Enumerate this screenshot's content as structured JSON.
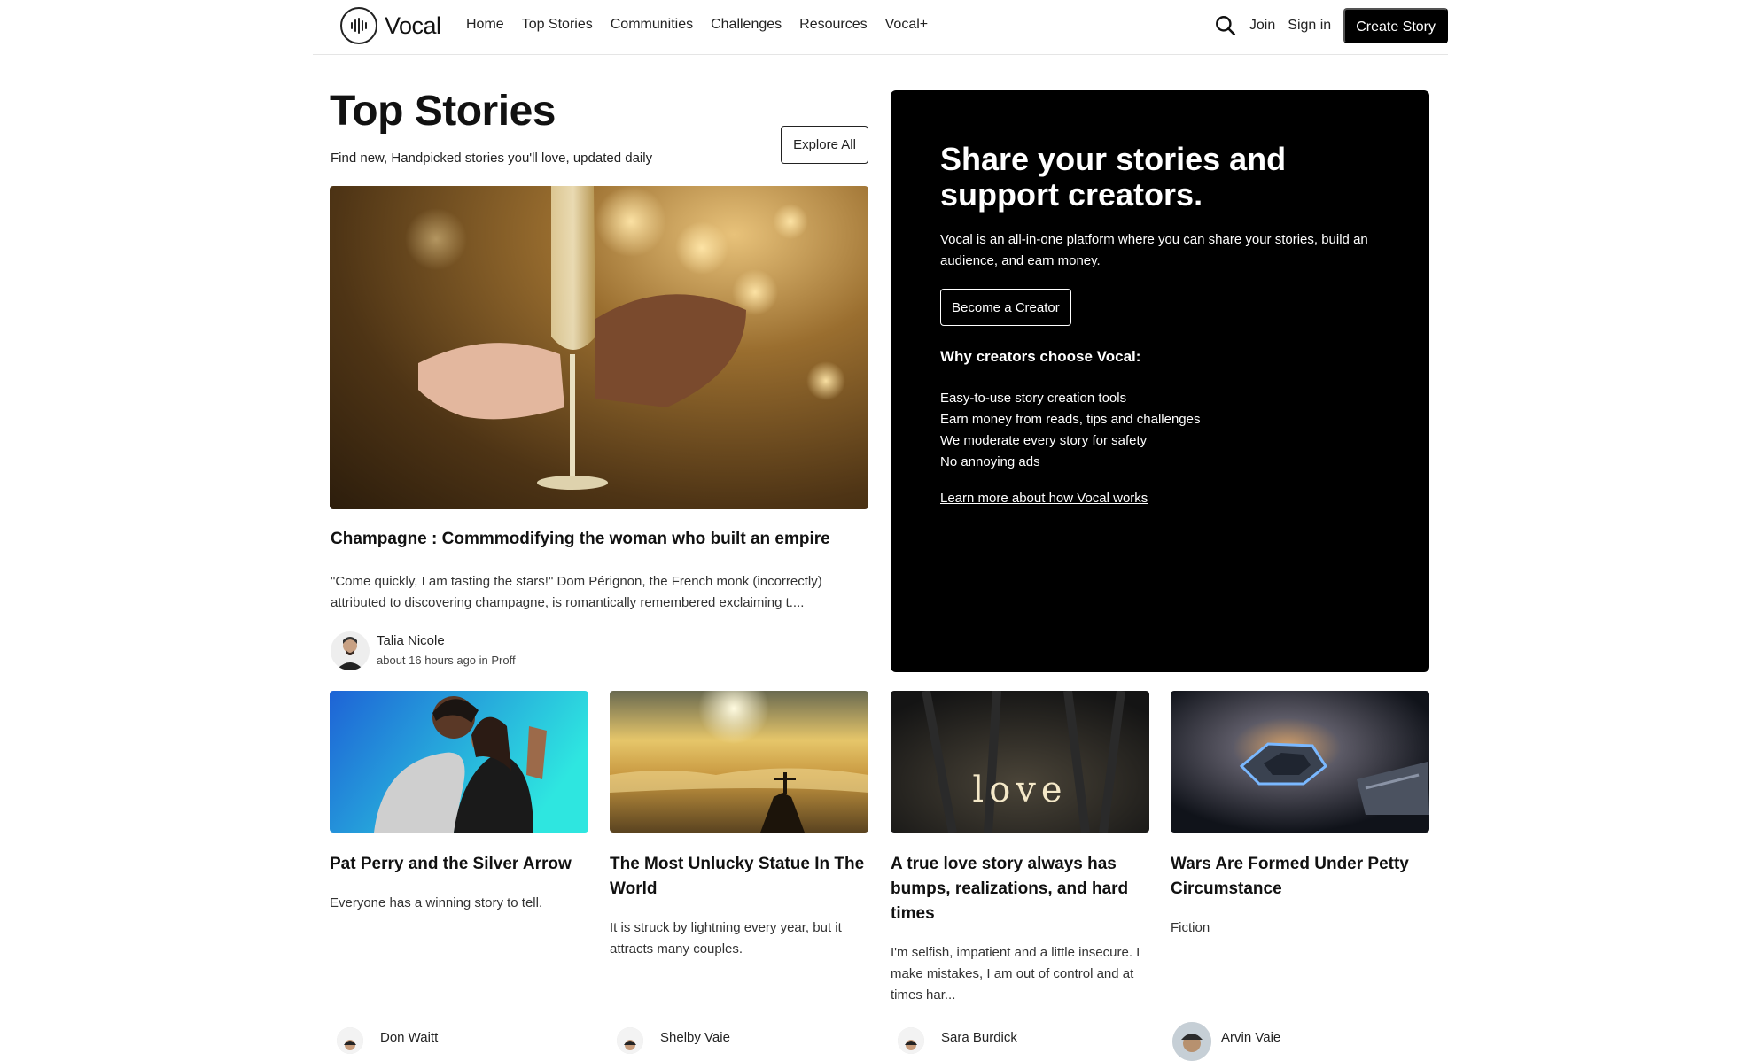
{
  "nav": {
    "logo_text": "Vocal",
    "links": [
      "Home",
      "Top Stories",
      "Communities",
      "Challenges",
      "Resources",
      "Vocal+"
    ],
    "join": "Join",
    "signin": "Sign in",
    "create": "Create Story"
  },
  "main": {
    "title": "Top Stories",
    "subtitle": "Find new, Handpicked stories you'll love, updated daily",
    "explore": "Explore All",
    "featured": {
      "title": "Champagne : Commmodifying the woman who built an empire",
      "excerpt": "\"Come quickly, I am tasting the stars!\" Dom Pérignon, the French monk (incorrectly) attributed to discovering champagne, is romantically remembered exclaiming t....",
      "author": "Talia Nicole",
      "meta": "about 16 hours ago in Proff"
    }
  },
  "promo": {
    "title": "Share your stories and support creators.",
    "description": "Vocal is an all-in-one platform where you can share your stories, build an audience, and earn money.",
    "cta": "Become a Creator",
    "why_heading": "Why creators choose Vocal:",
    "reasons": [
      "Easy-to-use story creation tools",
      "Earn money from reads, tips and challenges",
      "We moderate every story for safety",
      "No annoying ads"
    ],
    "learn_more": "Learn more about how Vocal works"
  },
  "cards": [
    {
      "title": "Pat Perry and the Silver Arrow",
      "excerpt": "Everyone has a winning story to tell.",
      "author": "Don Waitt"
    },
    {
      "title": "The Most Unlucky Statue In The World",
      "excerpt": "It is struck by lightning every year, but it attracts many couples.",
      "author": "Shelby Vaie"
    },
    {
      "title": "A true love story always has bumps, realizations, and hard times",
      "excerpt": "I'm selfish, impatient and a little insecure. I make mistakes, I am out of control and at times har...",
      "author": "Sara Burdick",
      "image_text": "love"
    },
    {
      "title": "Wars Are Formed Under Petty Circumstance",
      "excerpt": "Fiction",
      "author": "Arvin Vaie"
    }
  ],
  "colors": {
    "primary": "#000000",
    "background": "#ffffff",
    "text": "#111111"
  }
}
